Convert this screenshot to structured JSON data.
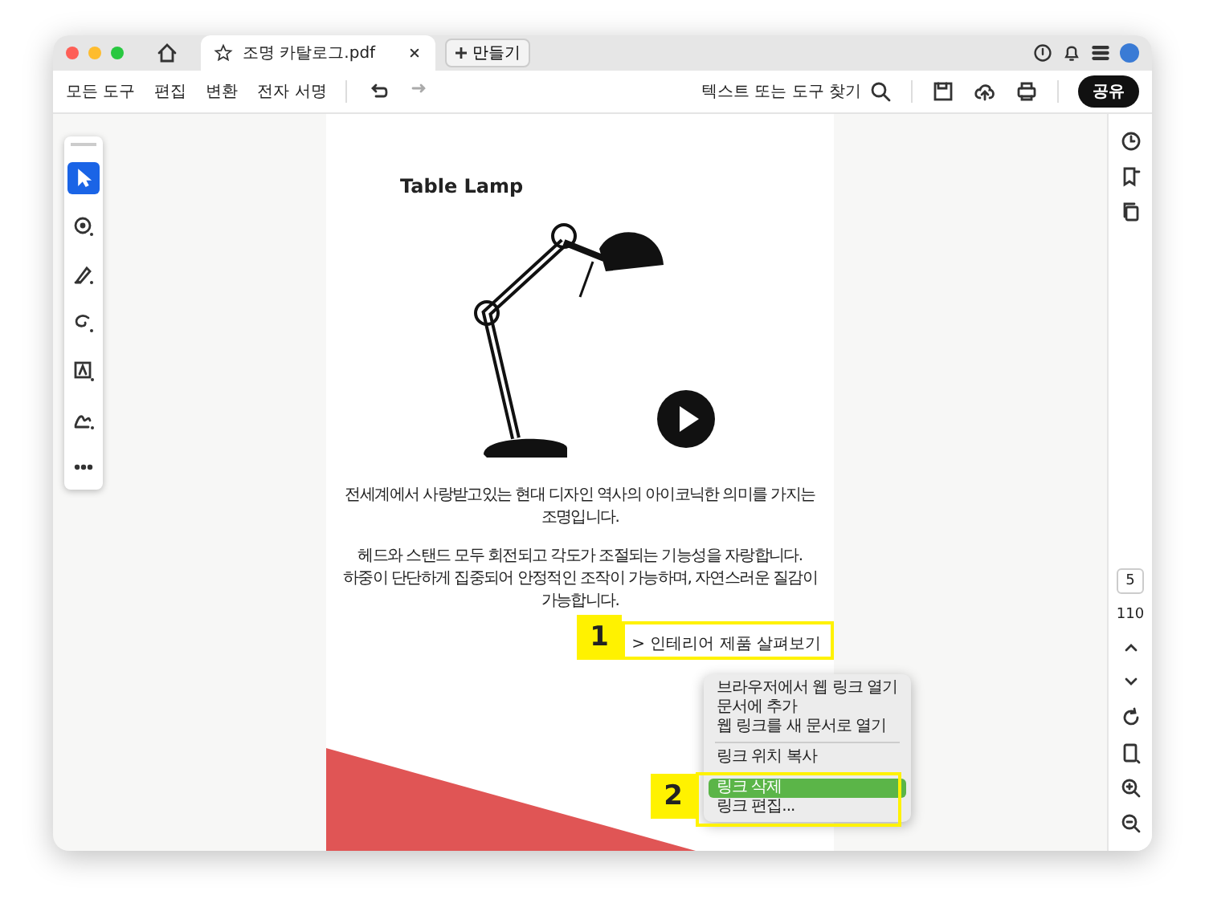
{
  "window": {
    "tab_title": "조명 카탈로그.pdf",
    "new_tab_label": "만들기"
  },
  "menu_bar": [
    {
      "label": "모든 도구"
    },
    {
      "label": "편집"
    },
    {
      "label": "변환"
    },
    {
      "label": "전자 서명"
    }
  ],
  "tool_search": {
    "label": "텍스트 또는 도구 찾기"
  },
  "share_button": "공유",
  "tools": [
    {
      "kind": "select",
      "selected": true
    },
    {
      "kind": "comment",
      "selected": false
    },
    {
      "kind": "pen",
      "selected": false
    },
    {
      "kind": "lasso",
      "selected": false
    },
    {
      "kind": "text",
      "selected": false
    },
    {
      "kind": "sign",
      "selected": false
    },
    {
      "kind": "more",
      "selected": false
    }
  ],
  "document": {
    "title": "Table Lamp",
    "paragraphs": [
      [
        "전세계에서 사랑받고있는 현대 디자인 역사의 아이코닉한 의미를 가지는 조명입니다."
      ],
      [
        "헤드와 스탠드 모두 회전되고 각도가 조절되는 기능성을 자랑합니다.",
        "하중이 단단하게 집중되어 안정적인 조작이 가능하며, 자연스러운 질감이 가능합니다."
      ]
    ],
    "link": "> 인테리어 제품 살펴보기"
  },
  "page_nav": {
    "current": "5",
    "total": "110"
  },
  "context_menu": {
    "items": [
      {
        "kind": "item",
        "label": "브라우저에서 웹 링크 열기",
        "selected": false
      },
      {
        "kind": "item",
        "label": "문서에 추가",
        "selected": false
      },
      {
        "kind": "item",
        "label": "웹 링크를 새 문서로 열기",
        "selected": false
      },
      {
        "kind": "separator"
      },
      {
        "kind": "item",
        "label": "링크 위치 복사",
        "selected": false
      },
      {
        "kind": "separator"
      },
      {
        "kind": "item",
        "label": "링크 삭제",
        "selected": true
      },
      {
        "kind": "item",
        "label": "링크 편집...",
        "selected": false
      }
    ]
  },
  "callouts": [
    "1",
    "2"
  ]
}
